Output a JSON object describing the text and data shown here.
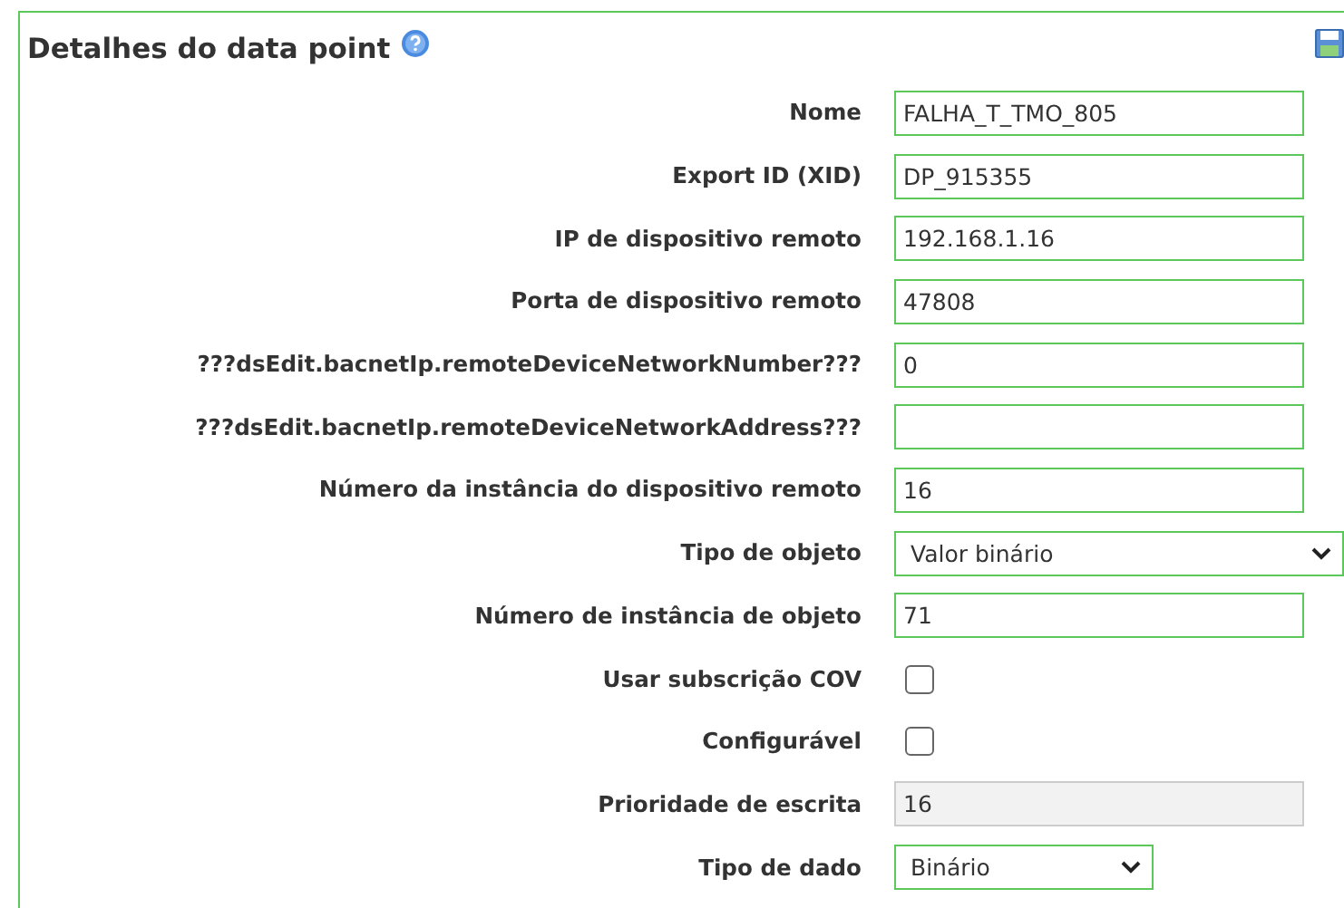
{
  "panel": {
    "title": "Detalhes do data point"
  },
  "fields": [
    {
      "kind": "text",
      "label": "Nome",
      "value": "FALHA_T_TMO_805"
    },
    {
      "kind": "text",
      "label": "Export ID (XID)",
      "value": "DP_915355"
    },
    {
      "kind": "text",
      "label": "IP de dispositivo remoto",
      "value": "192.168.1.16"
    },
    {
      "kind": "text",
      "label": "Porta de dispositivo remoto",
      "value": "47808"
    },
    {
      "kind": "text",
      "label": "???dsEdit.bacnetIp.remoteDeviceNetworkNumber???",
      "value": "0"
    },
    {
      "kind": "text",
      "label": "???dsEdit.bacnetIp.remoteDeviceNetworkAddress???"
    },
    {
      "kind": "text",
      "label": "Número da instância do dispositivo remoto",
      "value": "16"
    },
    {
      "kind": "select",
      "label": "Tipo de objeto",
      "value": "Valor binário",
      "wide": true
    },
    {
      "kind": "text",
      "label": "Número de instância de objeto",
      "value": "71"
    },
    {
      "kind": "checkbox",
      "label": "Usar subscrição COV",
      "checked": false
    },
    {
      "kind": "checkbox",
      "label": "Configurável",
      "checked": false
    },
    {
      "kind": "text",
      "label": "Prioridade de escrita",
      "value": "16",
      "disabled": true
    },
    {
      "kind": "select",
      "label": "Tipo de dado",
      "value": "Binário",
      "wide": false
    }
  ]
}
